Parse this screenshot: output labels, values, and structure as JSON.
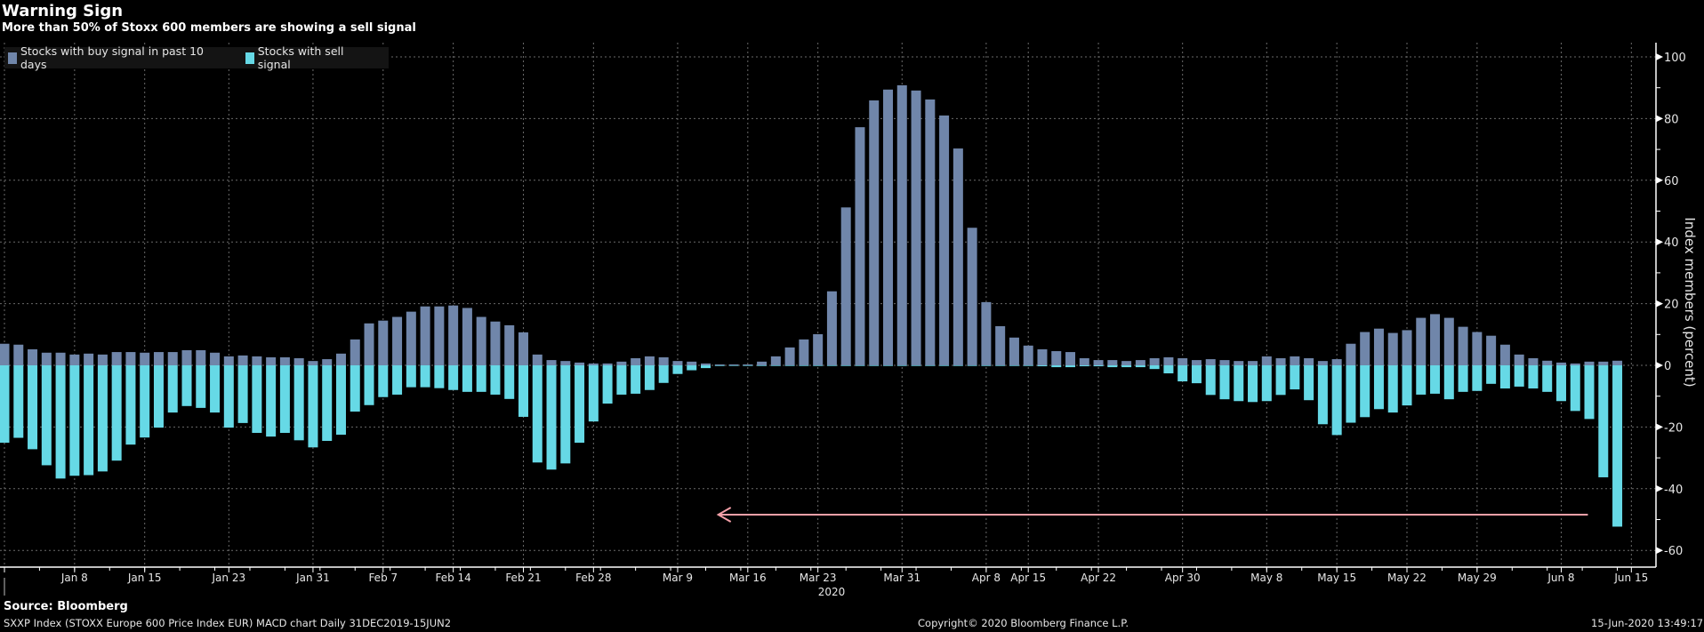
{
  "header": {
    "title": "Warning Sign",
    "subtitle": "More than 50% of Stoxx 600 members are showing a sell signal"
  },
  "footer": {
    "source": "Source: Bloomberg",
    "description": "SXXP Index (STOXX Europe 600 Price Index EUR) MACD chart  Daily 31DEC2019-15JUN2",
    "copyright": "Copyright© 2020 Bloomberg Finance L.P.",
    "timestamp": "15-Jun-2020 13:49:17"
  },
  "colors": {
    "background": "#000000",
    "buy": "#7086aa",
    "sell": "#66d9e6",
    "arrow": "#f4a0a8",
    "grid": "#6a6a6a"
  },
  "chart_data": {
    "type": "bar",
    "title": "Warning Sign",
    "subtitle": "More than 50% of Stoxx 600 members are showing a sell signal",
    "xlabel": "2020",
    "ylabel": "Index members (percent)",
    "ylim": [
      -60,
      100
    ],
    "yticks": [
      "100",
      "80",
      "60",
      "40",
      "20",
      "0",
      "-20",
      "-40",
      "-60"
    ],
    "ytick_values": [
      100,
      80,
      60,
      40,
      20,
      0,
      -20,
      -40,
      -60
    ],
    "grid": true,
    "legend_position": "top-left",
    "x_range": "31 Dec 2019 - 12 Jun 2020 (daily trading days)",
    "x_ticks": [
      {
        "label": "",
        "index": 0
      },
      {
        "label": "Jan 8",
        "index": 5
      },
      {
        "label": "Jan 15",
        "index": 10
      },
      {
        "label": "Jan 23",
        "index": 16
      },
      {
        "label": "Jan 31",
        "index": 22
      },
      {
        "label": "Feb 7",
        "index": 27
      },
      {
        "label": "Feb 14",
        "index": 32
      },
      {
        "label": "Feb 21",
        "index": 37
      },
      {
        "label": "Feb 28",
        "index": 42
      },
      {
        "label": "Mar 9",
        "index": 48
      },
      {
        "label": "Mar 16",
        "index": 53
      },
      {
        "label": "Mar 23",
        "index": 58
      },
      {
        "label": "Mar 31",
        "index": 64
      },
      {
        "label": "Apr 8",
        "index": 70
      },
      {
        "label": "Apr 15",
        "index": 73
      },
      {
        "label": "Apr 22",
        "index": 78
      },
      {
        "label": "Apr 30",
        "index": 84
      },
      {
        "label": "May 8",
        "index": 90
      },
      {
        "label": "May 15",
        "index": 95
      },
      {
        "label": "May 22",
        "index": 100
      },
      {
        "label": "May 29",
        "index": 105
      },
      {
        "label": "Jun 8",
        "index": 111
      },
      {
        "label": "Jun 15",
        "index": 116
      }
    ],
    "series": [
      {
        "name": "Stocks with buy signal in past 10 days",
        "color": "#7086aa",
        "values": [
          7.0,
          6.7,
          5.2,
          4.1,
          4.1,
          3.5,
          3.8,
          3.5,
          4.3,
          4.3,
          4.1,
          4.3,
          4.3,
          4.9,
          4.9,
          4.1,
          2.9,
          3.2,
          2.9,
          2.6,
          2.6,
          2.3,
          1.4,
          2.0,
          3.8,
          8.4,
          13.6,
          14.5,
          15.7,
          17.4,
          19.1,
          19.1,
          19.4,
          18.6,
          15.7,
          14.2,
          13.0,
          10.7,
          3.5,
          1.7,
          1.4,
          0.9,
          0.6,
          0.6,
          1.2,
          2.3,
          2.9,
          2.6,
          1.4,
          1.2,
          0.6,
          0.3,
          0.3,
          0.3,
          1.2,
          2.9,
          5.8,
          8.4,
          10.1,
          24.0,
          51.2,
          77.2,
          85.9,
          89.4,
          90.8,
          89.1,
          86.2,
          81.0,
          70.3,
          44.6,
          20.5,
          12.7,
          9.0,
          6.4,
          5.2,
          4.6,
          4.3,
          2.3,
          1.7,
          1.7,
          1.4,
          1.7,
          2.3,
          2.6,
          2.3,
          1.7,
          2.0,
          1.7,
          1.4,
          1.4,
          2.9,
          2.3,
          2.9,
          2.3,
          1.4,
          2.0,
          7.0,
          10.8,
          11.9,
          10.5,
          11.4,
          15.4,
          16.6,
          15.4,
          12.5,
          10.8,
          9.6,
          6.7,
          3.5,
          2.3,
          1.5,
          0.9,
          0.6,
          1.2,
          1.2,
          1.5
        ]
      },
      {
        "name": "Stocks with sell signal",
        "color": "#66d9e6",
        "values": [
          -25.1,
          -23.5,
          -27.2,
          -32.4,
          -36.7,
          -35.8,
          -35.6,
          -34.4,
          -30.9,
          -25.7,
          -23.4,
          -20.2,
          -15.3,
          -13.2,
          -13.8,
          -15.3,
          -20.2,
          -18.7,
          -21.9,
          -23.1,
          -21.9,
          -24.3,
          -26.6,
          -24.5,
          -22.5,
          -15.0,
          -12.9,
          -10.3,
          -9.5,
          -7.1,
          -7.1,
          -7.4,
          -8.0,
          -8.6,
          -8.6,
          -9.5,
          -10.9,
          -16.7,
          -31.5,
          -33.8,
          -31.8,
          -25.1,
          -18.2,
          -12.4,
          -9.5,
          -9.2,
          -8.0,
          -5.7,
          -2.8,
          -1.6,
          -0.9,
          -0.2,
          -0.1,
          -0.1,
          -0.2,
          -0.2,
          -0.2,
          -0.2,
          -0.2,
          -0.2,
          -0.2,
          -0.2,
          -0.2,
          -0.2,
          -0.2,
          -0.2,
          -0.2,
          -0.2,
          -0.2,
          -0.2,
          -0.2,
          -0.2,
          -0.2,
          -0.2,
          -0.3,
          -0.6,
          -0.6,
          -0.3,
          -0.3,
          -0.6,
          -0.6,
          -0.6,
          -1.2,
          -2.6,
          -5.2,
          -5.8,
          -9.6,
          -11.0,
          -11.6,
          -11.9,
          -11.6,
          -9.6,
          -7.8,
          -11.3,
          -19.1,
          -22.6,
          -18.6,
          -16.8,
          -14.2,
          -15.3,
          -13.0,
          -9.5,
          -9.2,
          -11.0,
          -8.6,
          -8.3,
          -6.0,
          -7.5,
          -6.9,
          -7.5,
          -8.6,
          -11.6,
          -14.8,
          -17.4,
          -36.3,
          -52.3
        ]
      }
    ],
    "annotations": [
      {
        "type": "arrow",
        "direction": "left",
        "y": -48.4,
        "x_from_index": 112.9,
        "x_to_index": 50.9,
        "color": "#f4a0a8"
      }
    ]
  }
}
